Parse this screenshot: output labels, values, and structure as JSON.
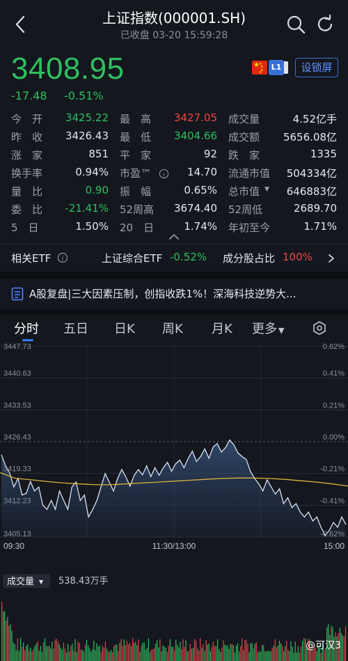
{
  "header": {
    "title": "上证指数(000001.SH)",
    "status": "已收盘 03-20 15:59:28"
  },
  "quote": {
    "price": "3408.95",
    "change": "-17.48",
    "change_pct": "-0.51%"
  },
  "badges": {
    "level": "L1",
    "lock_label": "设锁屏"
  },
  "stats": [
    [
      {
        "label": "今　开",
        "value": "3425.22",
        "color": "green"
      },
      {
        "label": "最　高",
        "value": "3427.05",
        "color": "red"
      },
      {
        "label": "成交量",
        "value": "4.52亿手",
        "color": "white"
      }
    ],
    [
      {
        "label": "昨　收",
        "value": "3426.43",
        "color": "white"
      },
      {
        "label": "最　低",
        "value": "3404.66",
        "color": "green"
      },
      {
        "label": "成交额",
        "value": "5656.08亿",
        "color": "white"
      }
    ],
    [
      {
        "label": "涨　家",
        "value": "851",
        "color": "white"
      },
      {
        "label": "平　家",
        "value": "92",
        "color": "white"
      },
      {
        "label": "跌　家",
        "value": "1335",
        "color": "white"
      }
    ],
    [
      {
        "label": "换手率",
        "value": "0.94%",
        "color": "white"
      },
      {
        "label": "市盈™",
        "value": "14.70",
        "color": "white"
      },
      {
        "label": "流通市值",
        "value": "504334亿",
        "color": "white"
      }
    ],
    [
      {
        "label": "量　比",
        "value": "0.90",
        "color": "green"
      },
      {
        "label": "振　幅",
        "value": "0.65%",
        "color": "white"
      },
      {
        "label": "总市值",
        "value": "646883亿",
        "color": "white"
      }
    ],
    [
      {
        "label": "委　比",
        "value": "-21.41%",
        "color": "green"
      },
      {
        "label": "52周高",
        "value": "3674.40",
        "color": "white"
      },
      {
        "label": "52周低",
        "value": "2689.70",
        "color": "white"
      }
    ],
    [
      {
        "label": "5　日",
        "value": "1.50%",
        "color": "white"
      },
      {
        "label": "20　日",
        "value": "1.74%",
        "color": "white"
      },
      {
        "label": "年初至今",
        "value": "1.71%",
        "color": "white"
      }
    ]
  ],
  "etf": {
    "label": "相关ETF",
    "name": "上证综合ETF",
    "name_change": "-0.52%",
    "ratio_label": "成分股占比",
    "ratio_value": "100%"
  },
  "news": {
    "text": "A股复盘|三大因素压制，创指收跌1%！深海科技逆势大..."
  },
  "tabs": [
    "分时",
    "五日",
    "日K",
    "周K",
    "月K",
    "更多"
  ],
  "chart_data": {
    "type": "line",
    "title": "",
    "y_ticks": [
      "3447.73",
      "3440.63",
      "3433.53",
      "3426.43",
      "3419.33",
      "3412.23",
      "3405.13"
    ],
    "pct_ticks": [
      "0.62%",
      "0.41%",
      "0.21%",
      "0.00%",
      "-0.21%",
      "-0.41%",
      "-0.62%"
    ],
    "x_ticks": [
      "09:30",
      "11:30/13:00",
      "15:00"
    ],
    "ylim": [
      3405.13,
      3447.73
    ],
    "prev_close": 3426.43,
    "series": [
      {
        "values": [
          3423.5,
          3421,
          3419.4,
          3416.3,
          3418.2,
          3414.5,
          3414.9,
          3417.5,
          3415.4,
          3416.3,
          3412.2,
          3411.3,
          3413.3,
          3411.3,
          3415.4,
          3413.3,
          3411.3,
          3416.3,
          3417.4,
          3413.3,
          3414.5,
          3409.6,
          3411.3,
          3413.3,
          3416.3,
          3419.3,
          3417.4,
          3415.4,
          3418.2,
          3420.2,
          3418.5,
          3416.5,
          3418.9,
          3420.2,
          3419.0,
          3421.0,
          3418.6,
          3420.6,
          3418.9,
          3420.6,
          3421.8,
          3419.8,
          3421.5,
          3422.3,
          3420.6,
          3422.7,
          3424.3,
          3422.0,
          3423.1,
          3424.8,
          3422.7,
          3425.2,
          3426.0,
          3424.1,
          3425.1,
          3426.8,
          3425.7,
          3423.9,
          3423.1,
          3422.4,
          3419.8,
          3418.2,
          3417.0,
          3415.4,
          3417.9,
          3416.3,
          3414.7,
          3415.9,
          3412.6,
          3413.9,
          3411.7,
          3412.6,
          3410.7,
          3409.6,
          3410.7,
          3408.7,
          3409.6,
          3407.3,
          3405.5,
          3406.6,
          3408.4,
          3407.3,
          3409.6,
          3407.9
        ]
      },
      {
        "values": [
          3419.5,
          3418.2,
          3417.9,
          3417.5,
          3417.2,
          3417.0,
          3416.8,
          3416.8,
          3417.0,
          3417.2,
          3417.4,
          3417.6,
          3417.8,
          3418.0,
          3418.2,
          3418.3,
          3418.3,
          3418.2,
          3418.0,
          3417.7,
          3417.4,
          3417.0,
          3416.5
        ]
      }
    ],
    "volume_label": "成交量",
    "volume_value": "538.43万手"
  },
  "watermark": "@可汉3"
}
